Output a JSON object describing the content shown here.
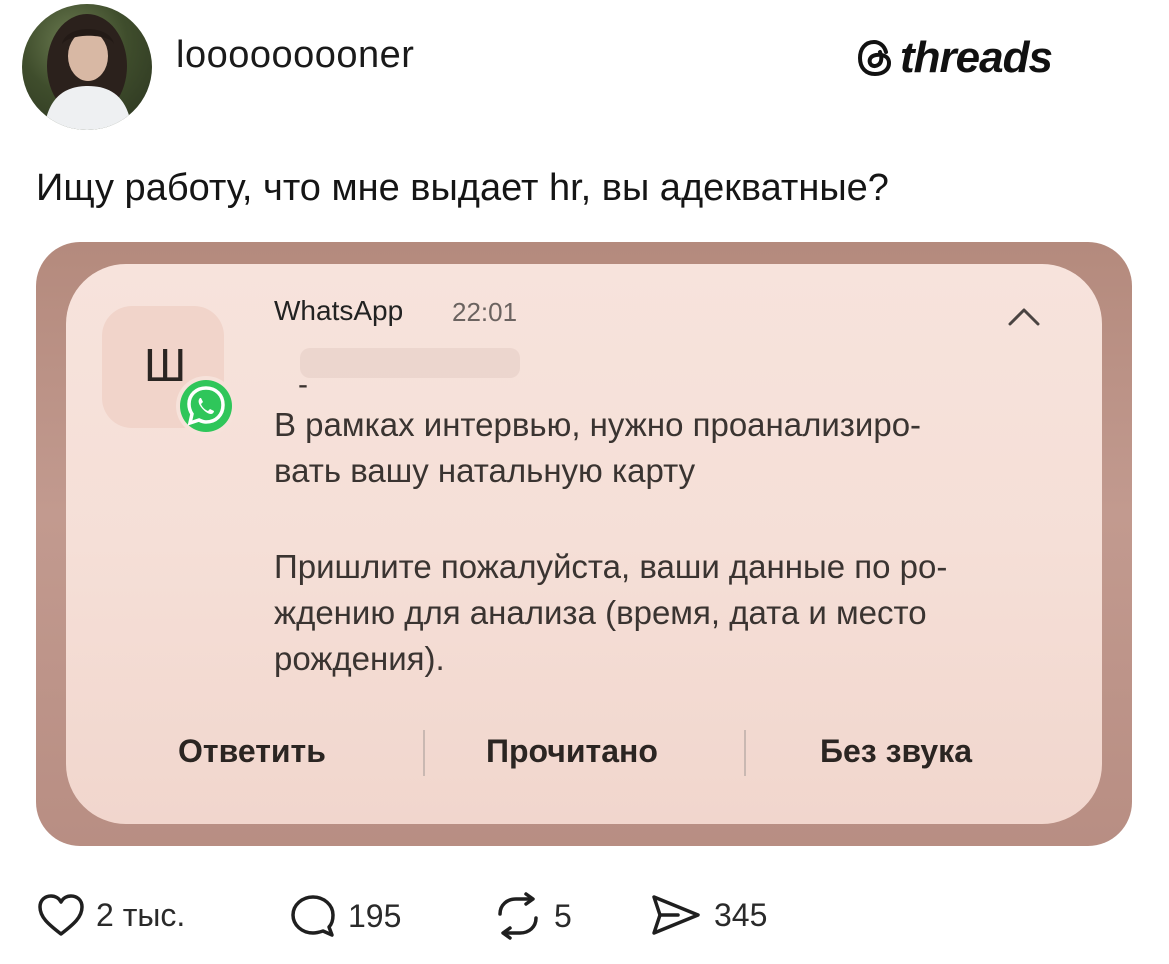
{
  "header": {
    "username": "looooooooner",
    "brand": "threads"
  },
  "post": {
    "text": "Ищу работу, что мне выдает hr, вы адекватные?"
  },
  "notification": {
    "app_letter": "Ш",
    "app_name": "WhatsApp",
    "time": "22:01",
    "sender": "-",
    "message_lines_1": [
      "В рамках интервью, нужно проанализиро-",
      "вать вашу натальную карту"
    ],
    "message_lines_2": [
      "Пришлите пожалуйста, ваши данные по ро-",
      "ждению для анализа (время, дата и место",
      "рождения)."
    ],
    "actions": {
      "reply": "Ответить",
      "read": "Прочитано",
      "mute": "Без звука"
    }
  },
  "stats": {
    "likes": "2 тыс.",
    "replies": "195",
    "reposts": "5",
    "shares": "345"
  },
  "colors": {
    "whatsapp_green": "#2fc65a",
    "card_frame": "#b88e83",
    "card_fill": "#f5dfd7"
  }
}
